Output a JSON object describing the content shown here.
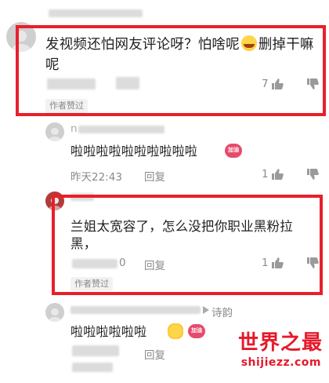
{
  "comments": [
    {
      "text_line1": "发视频还怕网友评论呀？怕啥呢",
      "text_line1b": "删掉干嘛",
      "text_line2": "呢",
      "likes": "7",
      "badge": "作者赞过",
      "emoji": "rofl-emoji"
    },
    {
      "author_partial": "n",
      "text": "啦啦啦啦啦啦啦啦啦啦",
      "sticker": "加油",
      "time": "昨天22:43",
      "reply": "回复",
      "likes": "1"
    },
    {
      "text_line1": "兰姐太宽容了，怎么没把你职业黑粉拉",
      "text_line2": "黑，",
      "time_partial": "0",
      "reply": "回复",
      "likes": "1",
      "badge": "作者赞过"
    },
    {
      "author_suffix": "诗韵",
      "text": "啦啦啦啦啦啦",
      "sticker": "加油",
      "reply": "回复"
    }
  ],
  "watermark": {
    "title": "世界之最",
    "url": "shijiezz.com"
  },
  "colors": {
    "highlight": "#e8202a",
    "meta_text": "#8a8a8a",
    "watermark": "#e6192b"
  }
}
